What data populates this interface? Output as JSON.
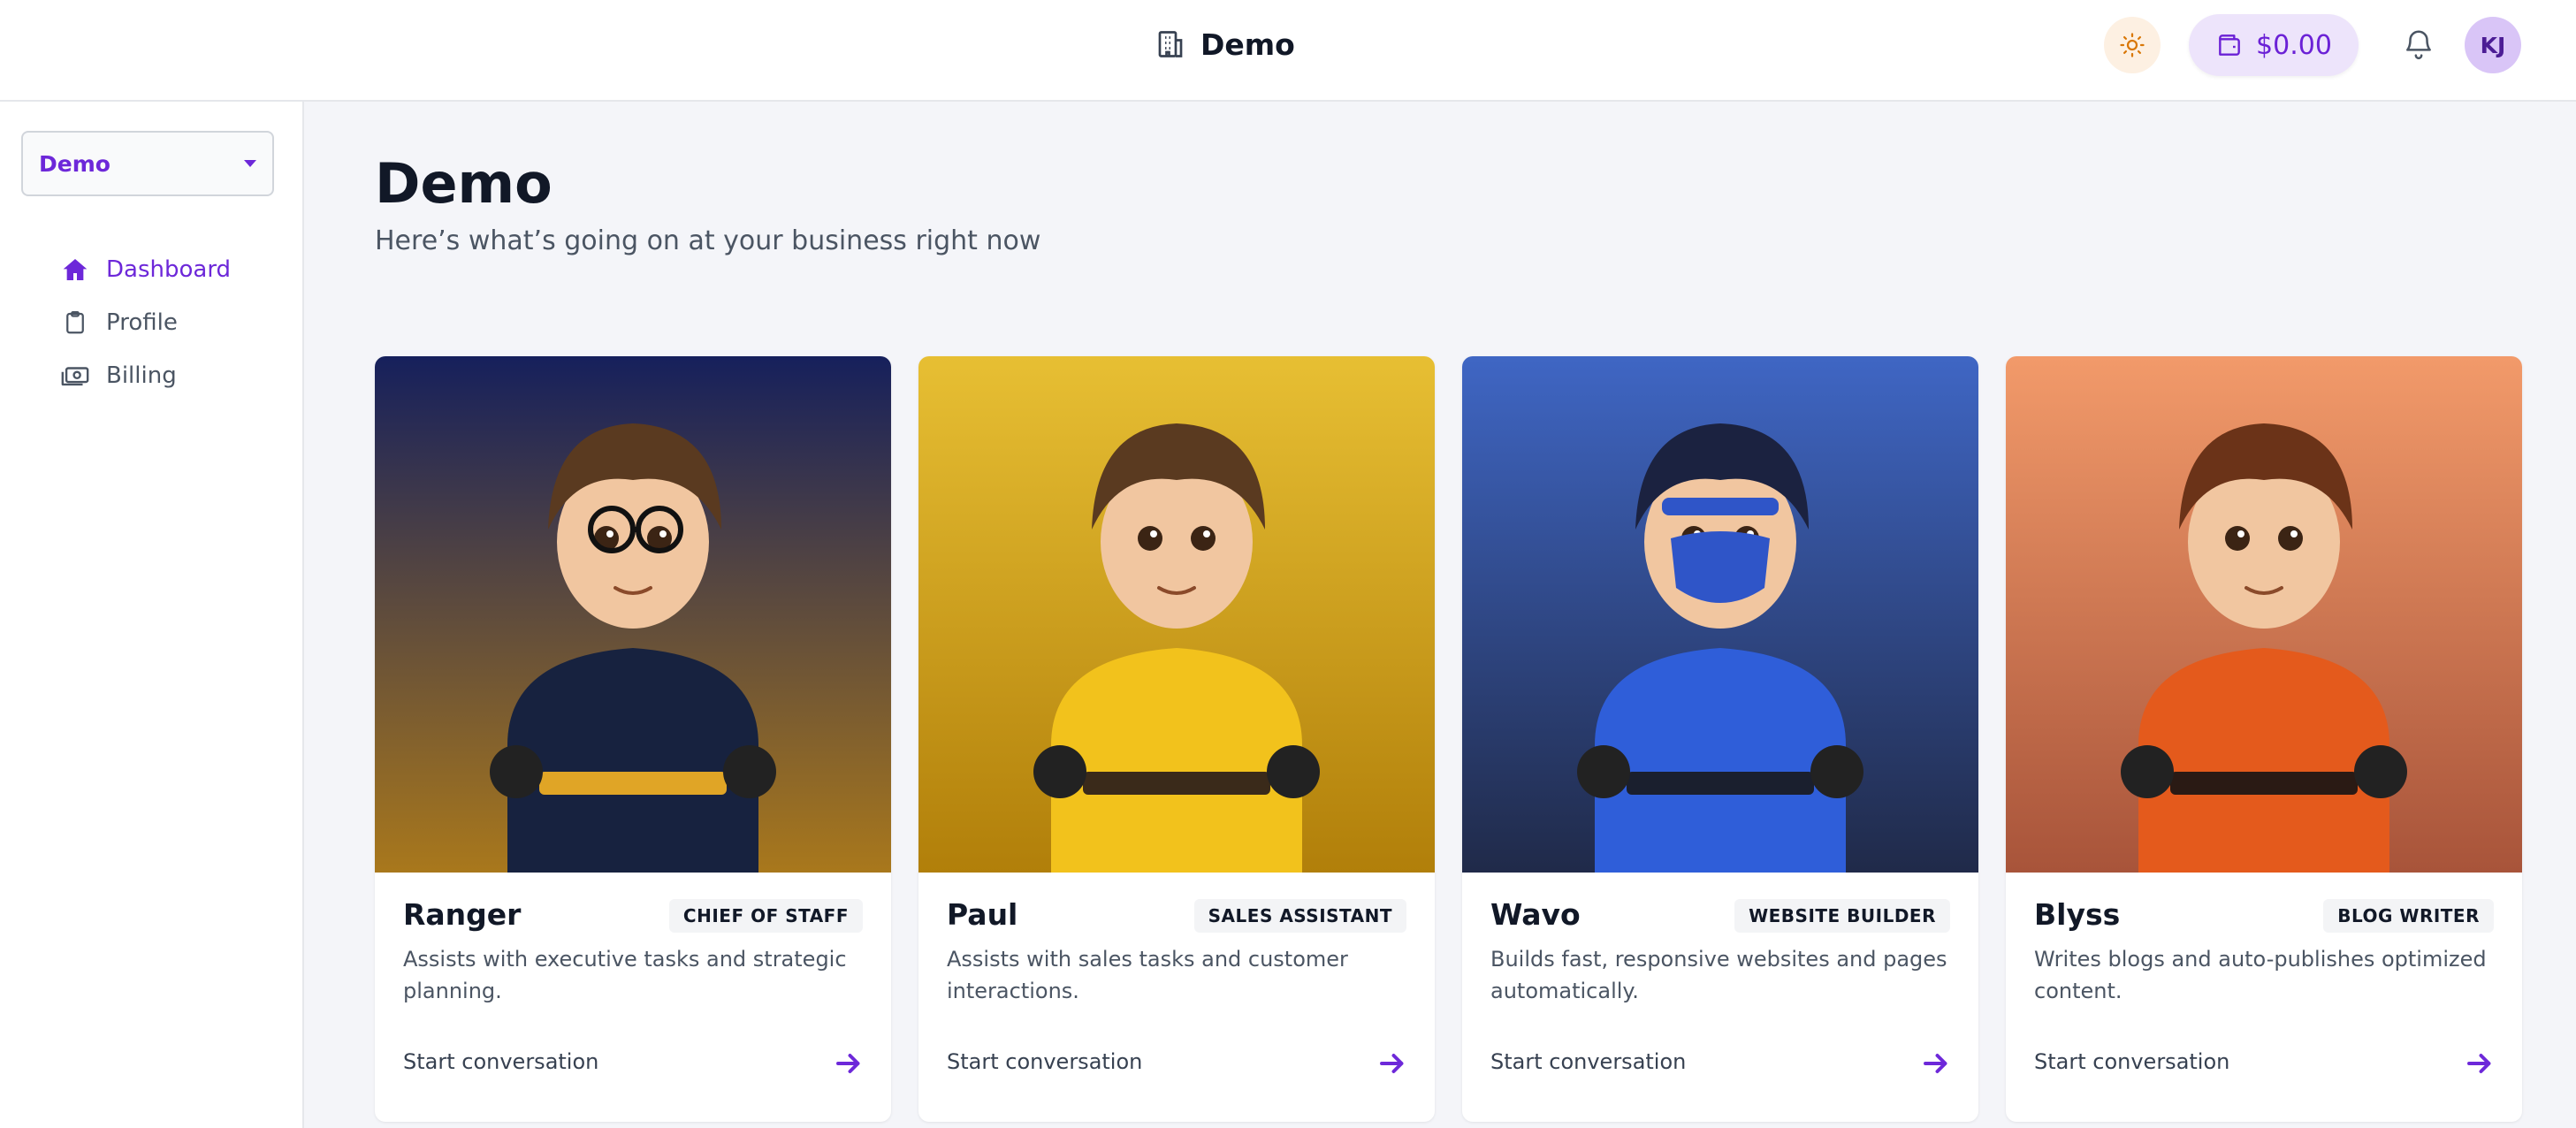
{
  "header": {
    "brand_icon": "building-icon",
    "brand_title": "Demo",
    "theme_icon": "sun-icon",
    "wallet_icon": "wallet-icon",
    "wallet_amount": "$0.00",
    "bell_icon": "bell-icon",
    "avatar_initials": "KJ"
  },
  "sidebar": {
    "org_select_value": "Demo",
    "items": [
      {
        "label": "Dashboard",
        "icon": "home-icon",
        "active": true
      },
      {
        "label": "Profile",
        "icon": "clipboard-icon",
        "active": false
      },
      {
        "label": "Billing",
        "icon": "cash-icon",
        "active": false
      }
    ]
  },
  "main": {
    "title": "Demo",
    "subtitle": "Here’s what’s going on at your business right now",
    "cards": [
      {
        "name": "Ranger",
        "role": "CHIEF OF STAFF",
        "description": "Assists with executive tasks and strategic planning.",
        "cta": "Start conversation",
        "bg_top": "#16205c",
        "bg_bottom": "#a9781c",
        "outfit": "#17223f",
        "accent": "#e0a526"
      },
      {
        "name": "Paul",
        "role": "SALES ASSISTANT",
        "description": "Assists with sales tasks and customer interactions.",
        "cta": "Start conversation",
        "bg_top": "#e7bf33",
        "bg_bottom": "#b17f0a",
        "outfit": "#f2c21c",
        "accent": "#3a2a1a"
      },
      {
        "name": "Wavo",
        "role": "WEBSITE BUILDER",
        "description": "Builds fast, responsive websites and pages automatically.",
        "cta": "Start conversation",
        "bg_top": "#3f66c4",
        "bg_bottom": "#202a49",
        "outfit": "#2f5ed9",
        "accent": "#1a1f2e"
      },
      {
        "name": "Blyss",
        "role": "BLOG WRITER",
        "description": "Writes blogs and auto-publishes optimized content.",
        "cta": "Start conversation",
        "bg_top": "#f29a6a",
        "bg_bottom": "#a8543a",
        "outfit": "#e45a1c",
        "accent": "#2a1a14"
      }
    ]
  },
  "colors": {
    "accent": "#6d28d9",
    "arrow": "#6d28d9"
  }
}
